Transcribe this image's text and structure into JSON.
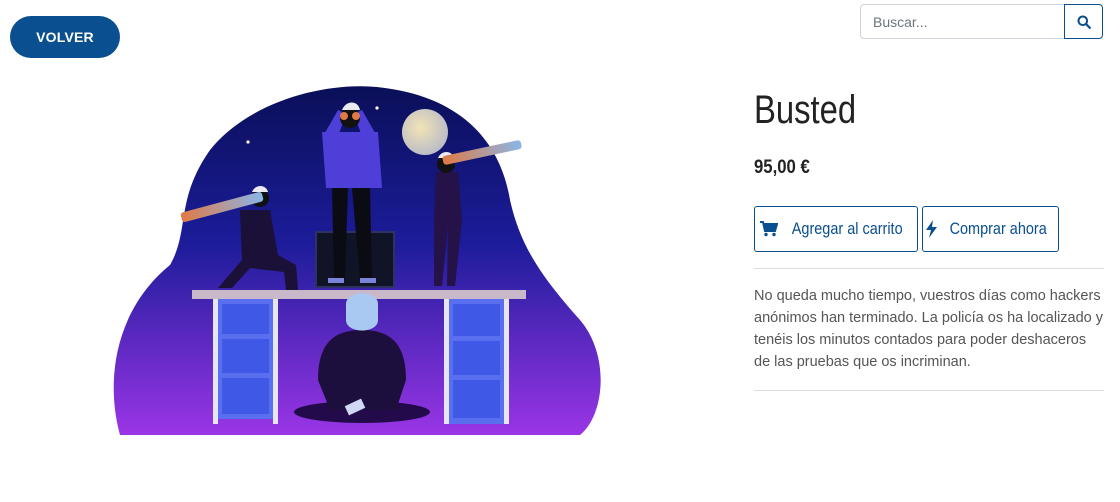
{
  "nav": {
    "back_label": "VOLVER"
  },
  "search": {
    "placeholder": "Buscar...",
    "icon": "search-icon"
  },
  "product": {
    "title": "Busted",
    "price": "95,00 €",
    "add_to_cart_label": "Agregar al carrito",
    "buy_now_label": "Comprar ahora",
    "description": "No queda mucho tiempo, vuestros días como hackers anónimos han terminado. La policía os ha localizado y tenéis los minutos contados para poder deshaceros de las pruebas que os incriminan."
  },
  "colors": {
    "primary": "#0a4f8f",
    "illustration_top": "#0b1260",
    "illustration_bottom": "#8a2be2"
  }
}
